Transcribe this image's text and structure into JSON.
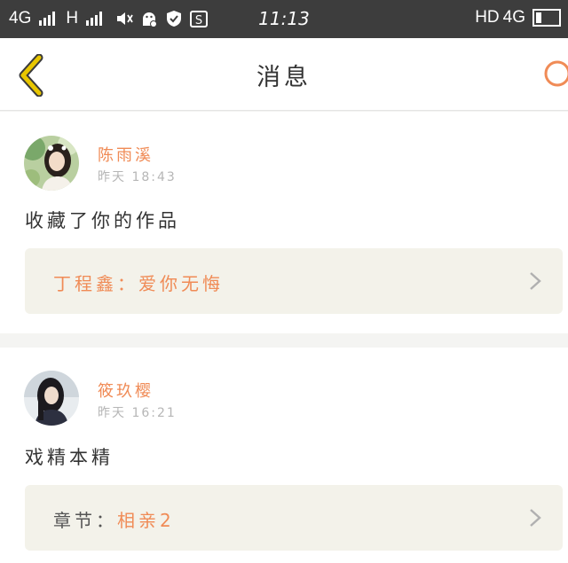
{
  "status_bar": {
    "network1": "4G",
    "network2": "H",
    "time": "11:13",
    "hd": "HD",
    "network3": "4G"
  },
  "header": {
    "title": "消息"
  },
  "messages": [
    {
      "username": "陈雨溪",
      "time": "昨天 18:43",
      "text": "收藏了你的作品",
      "ref_label": "",
      "ref_value": "丁程鑫：爱你无悔"
    },
    {
      "username": "筱玖樱",
      "time": "昨天 16:21",
      "text": "戏精本精",
      "ref_label": "章节：",
      "ref_value": "相亲2"
    }
  ],
  "colors": {
    "accent": "#f08b56",
    "back_arrow": "#e8c600",
    "status_bg": "#3d3d3d",
    "ref_bg": "#f3f2ea"
  }
}
